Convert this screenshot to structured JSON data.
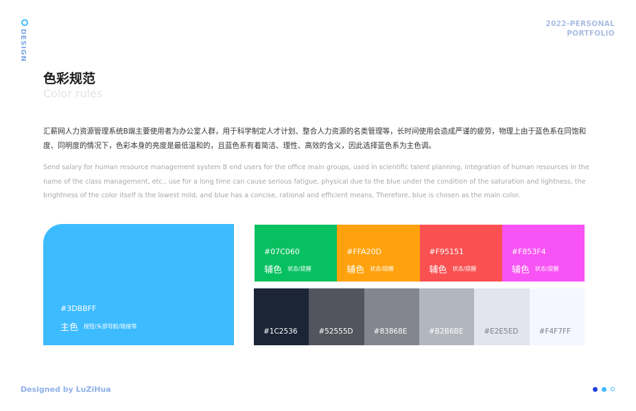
{
  "side_label": "DESIGN",
  "header": {
    "line1": "2022-PERSONAL",
    "line2": "PORTFOLIO"
  },
  "title": {
    "cn": "色彩规范",
    "en": "Color rules"
  },
  "description": {
    "cn": "汇薪网人力资源管理系统B端主要使用者为办公室人群，用于科学制定人才计划、整合人力资源的名类管理等，长时间使用会造成严谨的疲劳，物理上由于蓝色系在同饱和度、同明度的情况下，色彩本身的亮度是最低温和的，且蓝色系有着简洁、理性、高效的含义，因此选择蓝色系为主色调。",
    "en": "Send salary for human resource management system B end users for the office main groups, used in scientific talent planning, integration of human resources in the name of the class management, etc., use for a long time can cause serious fatigue, physical due to the blue under the condition of the saturation and lightness, the brightness of the color itself is the lowest mild, and blue has a concise, rational and efficient means, Therefore, blue is chosen as the main color."
  },
  "primary": {
    "hex": "#3DBBFF",
    "name": "主色",
    "note": "按钮/头部导航/链接等",
    "color": "#3DBBFF"
  },
  "auxiliary": [
    {
      "hex": "#07C060",
      "name": "辅色",
      "note": "状态/提醒",
      "color": "#07C060"
    },
    {
      "hex": "#FFA20D",
      "name": "辅色",
      "note": "状态/提醒",
      "color": "#FFA20D"
    },
    {
      "hex": "#F95151",
      "name": "辅色",
      "note": "状态/提醒",
      "color": "#F95151"
    },
    {
      "hex": "#F853F4",
      "name": "辅色",
      "note": "状态/提醒",
      "color": "#F853F4"
    }
  ],
  "neutrals": [
    {
      "hex": "#1C2536",
      "color": "#1C2536",
      "text_color": "#ffffff"
    },
    {
      "hex": "#52555D",
      "color": "#52555D",
      "text_color": "#ffffff"
    },
    {
      "hex": "#83868E",
      "color": "#83868E",
      "text_color": "#ffffff"
    },
    {
      "hex": "#B2B6BE",
      "color": "#B2B6BE",
      "text_color": "#ffffff"
    },
    {
      "hex": "#E2E5ED",
      "color": "#E2E5ED",
      "text_color": "#7c8088"
    },
    {
      "hex": "#F4F7FF",
      "color": "#F4F7FF",
      "text_color": "#7c8088"
    }
  ],
  "footer": "Designed by LuZiHua",
  "indicator_colors": [
    "#1E3FE0",
    "#3DBBFF",
    "#3DBBFF"
  ]
}
